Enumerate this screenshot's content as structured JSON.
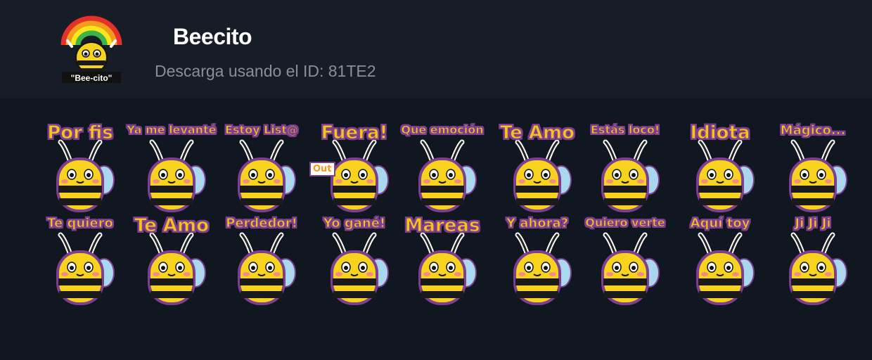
{
  "pack": {
    "title": "Beecito",
    "subtitle": "Descarga usando el ID: 81TE2",
    "icon": {
      "name": "rainbow-bee-icon",
      "label": "\"Bee-cito\""
    }
  },
  "colors": {
    "header_bg": "#161d26",
    "page_bg": "#111720",
    "caption_fill": "#f7c21a",
    "caption_outline": "#7d3f8f",
    "bee_yellow": "#f7d21f",
    "bee_stripe": "#1a1a1a",
    "wing_blue": "#a9d8ee"
  },
  "stickers": [
    {
      "caption": "Por fis"
    },
    {
      "caption": "Ya me levanté"
    },
    {
      "caption": "Estoy List@"
    },
    {
      "caption": "Fuera!",
      "sign": "Out"
    },
    {
      "caption": "Que emoción"
    },
    {
      "caption": "Te Amo"
    },
    {
      "caption": "Estás loco!"
    },
    {
      "caption": "Idiota"
    },
    {
      "caption": "Mágico..."
    },
    {
      "caption": "Te quiero"
    },
    {
      "caption": "Te Amo"
    },
    {
      "caption": "Perdedor!"
    },
    {
      "caption": "Yo gané!"
    },
    {
      "caption": "Mareas"
    },
    {
      "caption": "Y ahora?"
    },
    {
      "caption": "Quiero verte"
    },
    {
      "caption": "Aquí toy"
    },
    {
      "caption": "Ji Ji Ji"
    }
  ]
}
